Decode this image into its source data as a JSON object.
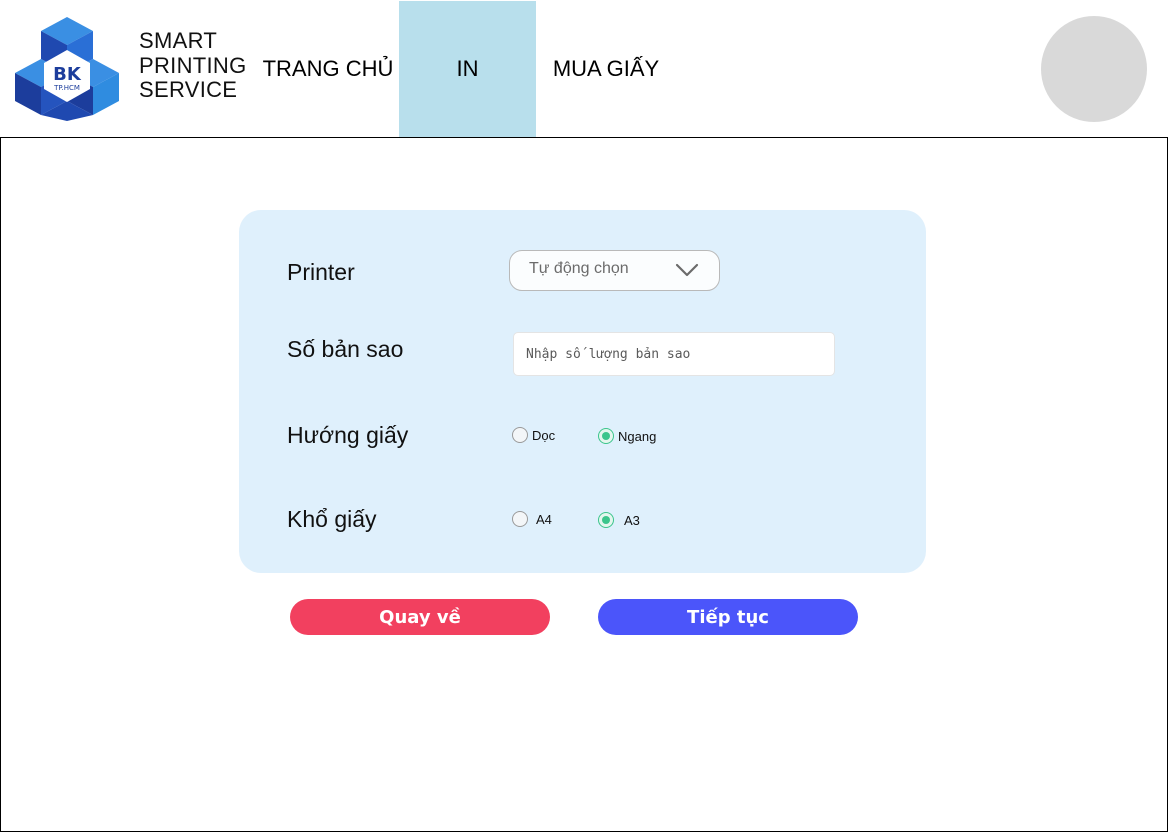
{
  "brand": {
    "logo_text": "BK",
    "logo_subtext": "TP.HCM",
    "lines": [
      "SMART",
      "PRINTING",
      "SERVICE"
    ]
  },
  "nav": {
    "items": [
      {
        "label": "TRANG CHỦ",
        "active": false
      },
      {
        "label": "IN",
        "active": true
      },
      {
        "label": "MUA GIẤY",
        "active": false
      }
    ]
  },
  "form": {
    "printer": {
      "label": "Printer",
      "value": "Tự động chọn"
    },
    "copies": {
      "label": "Số bản sao",
      "placeholder": "Nhập số lượng bản sao"
    },
    "orientation": {
      "label": "Hướng giấy",
      "options": [
        {
          "label": "Dọc",
          "checked": false
        },
        {
          "label": "Ngang",
          "checked": true
        }
      ]
    },
    "paper_size": {
      "label": "Khổ giấy",
      "options": [
        {
          "label": "A4",
          "checked": false
        },
        {
          "label": "A3",
          "checked": true
        }
      ]
    }
  },
  "actions": {
    "back_label": "Quay về",
    "next_label": "Tiếp tục"
  },
  "colors": {
    "nav_active_bg": "#b8dfec",
    "card_bg": "#dff0fc",
    "radio_checked": "#3cc58c",
    "back_button": "#f2405f",
    "next_button": "#4b55fa",
    "avatar": "#d9d9d9",
    "logo_blue_dark": "#1c3d9c",
    "logo_blue_light": "#2f8ce0"
  },
  "icons": {
    "logo": "bk-hexagon-logo",
    "dropdown": "chevron-down-icon",
    "avatar": "user-avatar-placeholder"
  }
}
